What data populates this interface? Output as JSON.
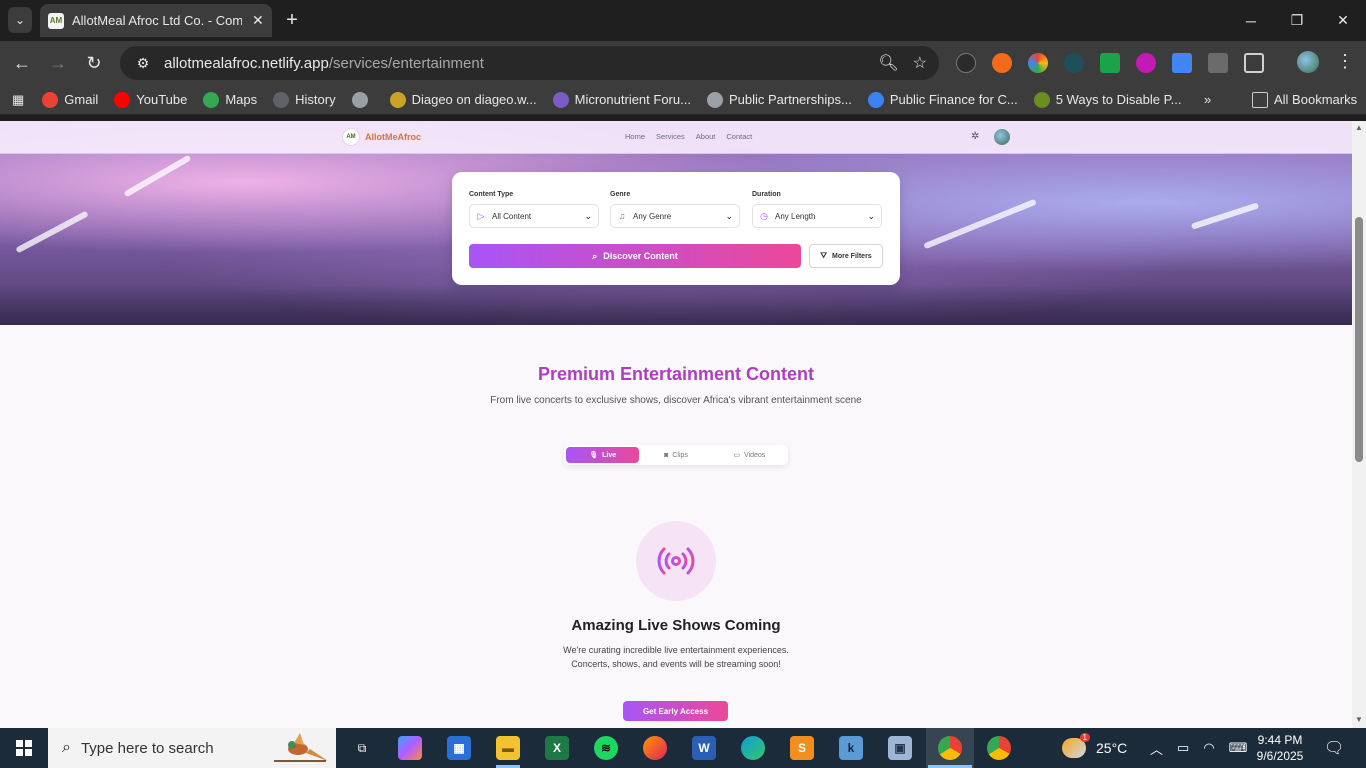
{
  "browser": {
    "tab_title": "AllotMeal Afroc Ltd Co. - Comp",
    "url_host": "allotmealafroc.netlify.app",
    "url_path": "/services/entertainment",
    "bookmarks": [
      {
        "label": "Gmail",
        "icon": "gmail-icon",
        "color": "#ea4335"
      },
      {
        "label": "YouTube",
        "icon": "youtube-icon",
        "color": "#ff0000"
      },
      {
        "label": "Maps",
        "icon": "maps-icon",
        "color": "#34a853"
      },
      {
        "label": "History",
        "icon": "history-icon",
        "color": "#5f6368"
      },
      {
        "label": "",
        "icon": "globe-icon",
        "color": "#9aa0a6"
      },
      {
        "label": "Diageo on diageo.w...",
        "icon": "diageo-icon",
        "color": "#c9a227"
      },
      {
        "label": "Micronutrient Foru...",
        "icon": "micronutrient-icon",
        "color": "#7b5cc7"
      },
      {
        "label": "Public Partnerships...",
        "icon": "globe-icon",
        "color": "#9aa0a6"
      },
      {
        "label": "Public Finance for C...",
        "icon": "finance-icon",
        "color": "#3b82f6"
      },
      {
        "label": "5 Ways to Disable P...",
        "icon": "article-icon",
        "color": "#6b8e23"
      }
    ],
    "all_bookmarks": "All Bookmarks"
  },
  "site": {
    "logo_text": "AllotMeAfroc",
    "nav": [
      "Home",
      "Services",
      "About",
      "Contact"
    ]
  },
  "filters": {
    "content_type_label": "Content Type",
    "content_type_value": "All Content",
    "genre_label": "Genre",
    "genre_value": "Any Genre",
    "duration_label": "Duration",
    "duration_value": "Any Length",
    "discover_button": "Discover Content",
    "more_filters_button": "More Filters"
  },
  "section": {
    "title": "Premium Entertainment Content",
    "subtitle": "From live concerts to exclusive shows, discover Africa's vibrant entertainment scene",
    "tabs": [
      "Live",
      "Clips",
      "Videos"
    ],
    "active_tab": "Live"
  },
  "coming": {
    "title": "Amazing Live Shows Coming",
    "text": "We're curating incredible live entertainment experiences. Concerts, shows, and events will be streaming soon!",
    "button": "Get Early Access"
  },
  "taskbar": {
    "search_placeholder": "Type here to search",
    "weather": "25°C",
    "weather_badge": "1",
    "time": "9:44 PM",
    "date": "9/6/2025"
  }
}
